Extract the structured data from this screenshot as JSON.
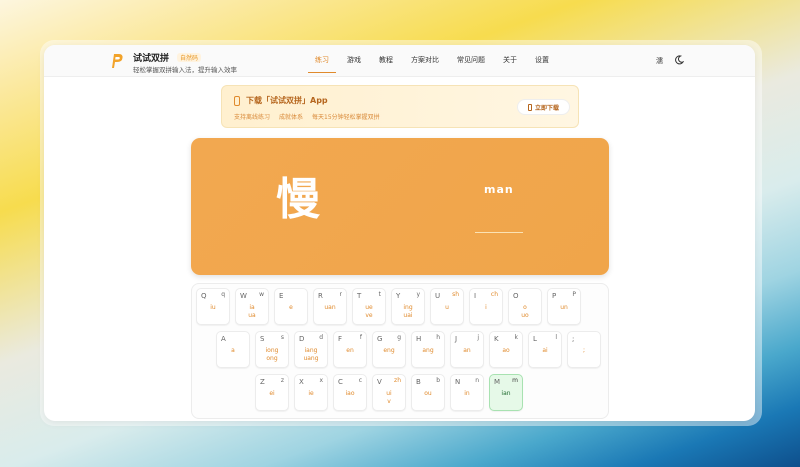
{
  "app": {
    "brand": "试试双拼",
    "badge": "自然码",
    "slogan": "轻松掌握双拼输入法，提升输入效率"
  },
  "nav": [
    {
      "label": "练习",
      "active": true
    },
    {
      "label": "游戏"
    },
    {
      "label": "教程"
    },
    {
      "label": "方案对比"
    },
    {
      "label": "常见问题"
    },
    {
      "label": "关于"
    },
    {
      "label": "设置"
    }
  ],
  "topbar": {
    "lang": "濡"
  },
  "promo": {
    "title": "下载「试试双拼」App",
    "subs": [
      "支持离线练习",
      "成就体系",
      "每天15分钟轻松掌握双拼"
    ],
    "button": "立即下载"
  },
  "practice": {
    "hanzi": "慢",
    "pinyin": "man",
    "input": ""
  },
  "keyboard": {
    "rows": [
      [
        {
          "k": "Q",
          "r": "q",
          "v": [
            "iu"
          ]
        },
        {
          "k": "W",
          "r": "w",
          "v": [
            "ia",
            "ua"
          ]
        },
        {
          "k": "E",
          "r": "",
          "v": [
            "e"
          ]
        },
        {
          "k": "R",
          "r": "r",
          "v": [
            "uan"
          ]
        },
        {
          "k": "T",
          "r": "t",
          "v": [
            "ue",
            "ve"
          ]
        },
        {
          "k": "Y",
          "r": "y",
          "v": [
            "ing",
            "uai"
          ]
        },
        {
          "k": "U",
          "r": "sh",
          "ro": true,
          "v": [
            "u"
          ]
        },
        {
          "k": "I",
          "r": "ch",
          "ro": true,
          "v": [
            "i"
          ]
        },
        {
          "k": "O",
          "r": "",
          "v": [
            "o",
            "uo"
          ]
        },
        {
          "k": "P",
          "r": "P",
          "v": [
            "un"
          ]
        }
      ],
      [
        {
          "k": "A",
          "r": "",
          "v": [
            "a"
          ]
        },
        {
          "k": "S",
          "r": "s",
          "v": [
            "iong",
            "ong"
          ]
        },
        {
          "k": "D",
          "r": "d",
          "v": [
            "iang",
            "uang"
          ]
        },
        {
          "k": "F",
          "r": "f",
          "v": [
            "en"
          ]
        },
        {
          "k": "G",
          "r": "g",
          "v": [
            "eng"
          ]
        },
        {
          "k": "H",
          "r": "h",
          "v": [
            "ang"
          ]
        },
        {
          "k": "J",
          "r": "j",
          "v": [
            "an"
          ]
        },
        {
          "k": "K",
          "r": "k",
          "v": [
            "ao"
          ]
        },
        {
          "k": "L",
          "r": "l",
          "v": [
            "ai"
          ]
        },
        {
          "k": ";",
          "r": "",
          "v": [
            ";"
          ]
        }
      ],
      [
        {
          "k": "Z",
          "r": "z",
          "v": [
            "ei"
          ]
        },
        {
          "k": "X",
          "r": "x",
          "v": [
            "ie"
          ]
        },
        {
          "k": "C",
          "r": "c",
          "v": [
            "iao"
          ]
        },
        {
          "k": "V",
          "r": "zh",
          "ro": true,
          "v": [
            "ui",
            "v"
          ]
        },
        {
          "k": "B",
          "r": "b",
          "v": [
            "ou"
          ]
        },
        {
          "k": "N",
          "r": "n",
          "v": [
            "in"
          ]
        },
        {
          "k": "M",
          "r": "m",
          "v": [
            "ian"
          ],
          "hl": true
        }
      ]
    ]
  }
}
